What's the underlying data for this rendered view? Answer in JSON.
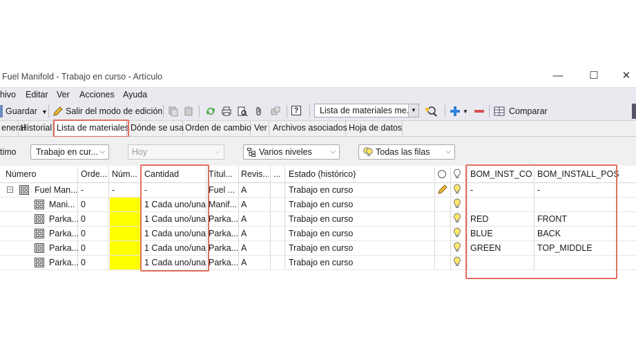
{
  "window": {
    "title": "Fuel Manifold - Trabajo en curso - Artículo",
    "minimize_glyph": "—",
    "maximize_glyph": "☐",
    "close_glyph": "✕"
  },
  "menu": {
    "items": [
      "hivo",
      "Editar",
      "Ver",
      "Acciones",
      "Ayuda"
    ]
  },
  "toolbar": {
    "save_label": "Guardar",
    "exit_edit_label": "Salir del modo de edición",
    "view_combo_value": "Lista de materiales me...",
    "compare_label": "Comparar",
    "help_glyph": "?"
  },
  "tabs": [
    "eneral",
    "Historial",
    "Lista de materiales",
    "Dónde se usa",
    "Orden de cambio",
    "Ver",
    "Archivos asociados",
    "Hoja de datos"
  ],
  "filters": {
    "first_label": "timo",
    "state_value": "Trabajo en cur...",
    "date_placeholder": "Hoy",
    "levels_value": "Varios niveles",
    "rows_value": "Todas las filas"
  },
  "columns": [
    "Número",
    "Orde...",
    "Núm...",
    "Cantidad",
    "Títul...",
    "Revis...",
    "...",
    "Estado (histórico)",
    "BOM_INST_CO...",
    "BOM_INSTALL_POS"
  ],
  "rows": [
    {
      "numero": "Fuel Man...",
      "orden": "-",
      "num": "-",
      "cantidad": "-",
      "titulo": "Fuel ...",
      "rev": "A",
      "estado": "Trabajo en curso",
      "inst_co": "-",
      "inst_pos": "-"
    },
    {
      "numero": "Mani...",
      "orden": "0",
      "num": "",
      "cantidad": "1 Cada uno/una",
      "titulo": "Manif...",
      "rev": "A",
      "estado": "Trabajo en curso",
      "inst_co": "",
      "inst_pos": ""
    },
    {
      "numero": "Parka...",
      "orden": "0",
      "num": "",
      "cantidad": "1 Cada uno/una",
      "titulo": "Parka...",
      "rev": "A",
      "estado": "Trabajo en curso",
      "inst_co": "RED",
      "inst_pos": "FRONT"
    },
    {
      "numero": "Parka...",
      "orden": "0",
      "num": "",
      "cantidad": "1 Cada uno/una",
      "titulo": "Parka...",
      "rev": "A",
      "estado": "Trabajo en curso",
      "inst_co": "BLUE",
      "inst_pos": "BACK"
    },
    {
      "numero": "Parka...",
      "orden": "0",
      "num": "",
      "cantidad": "1 Cada uno/una",
      "titulo": "Parka...",
      "rev": "A",
      "estado": "Trabajo en curso",
      "inst_co": "GREEN",
      "inst_pos": "TOP_MIDDLE"
    },
    {
      "numero": "Parka...",
      "orden": "0",
      "num": "",
      "cantidad": "1 Cada uno/una",
      "titulo": "Parka...",
      "rev": "A",
      "estado": "Trabajo en curso",
      "inst_co": "",
      "inst_pos": ""
    }
  ],
  "colors": {
    "highlight_box": "#e0705f",
    "yellow_cell": "#ffff00",
    "toolbar_bg": "#e9e9ef"
  }
}
